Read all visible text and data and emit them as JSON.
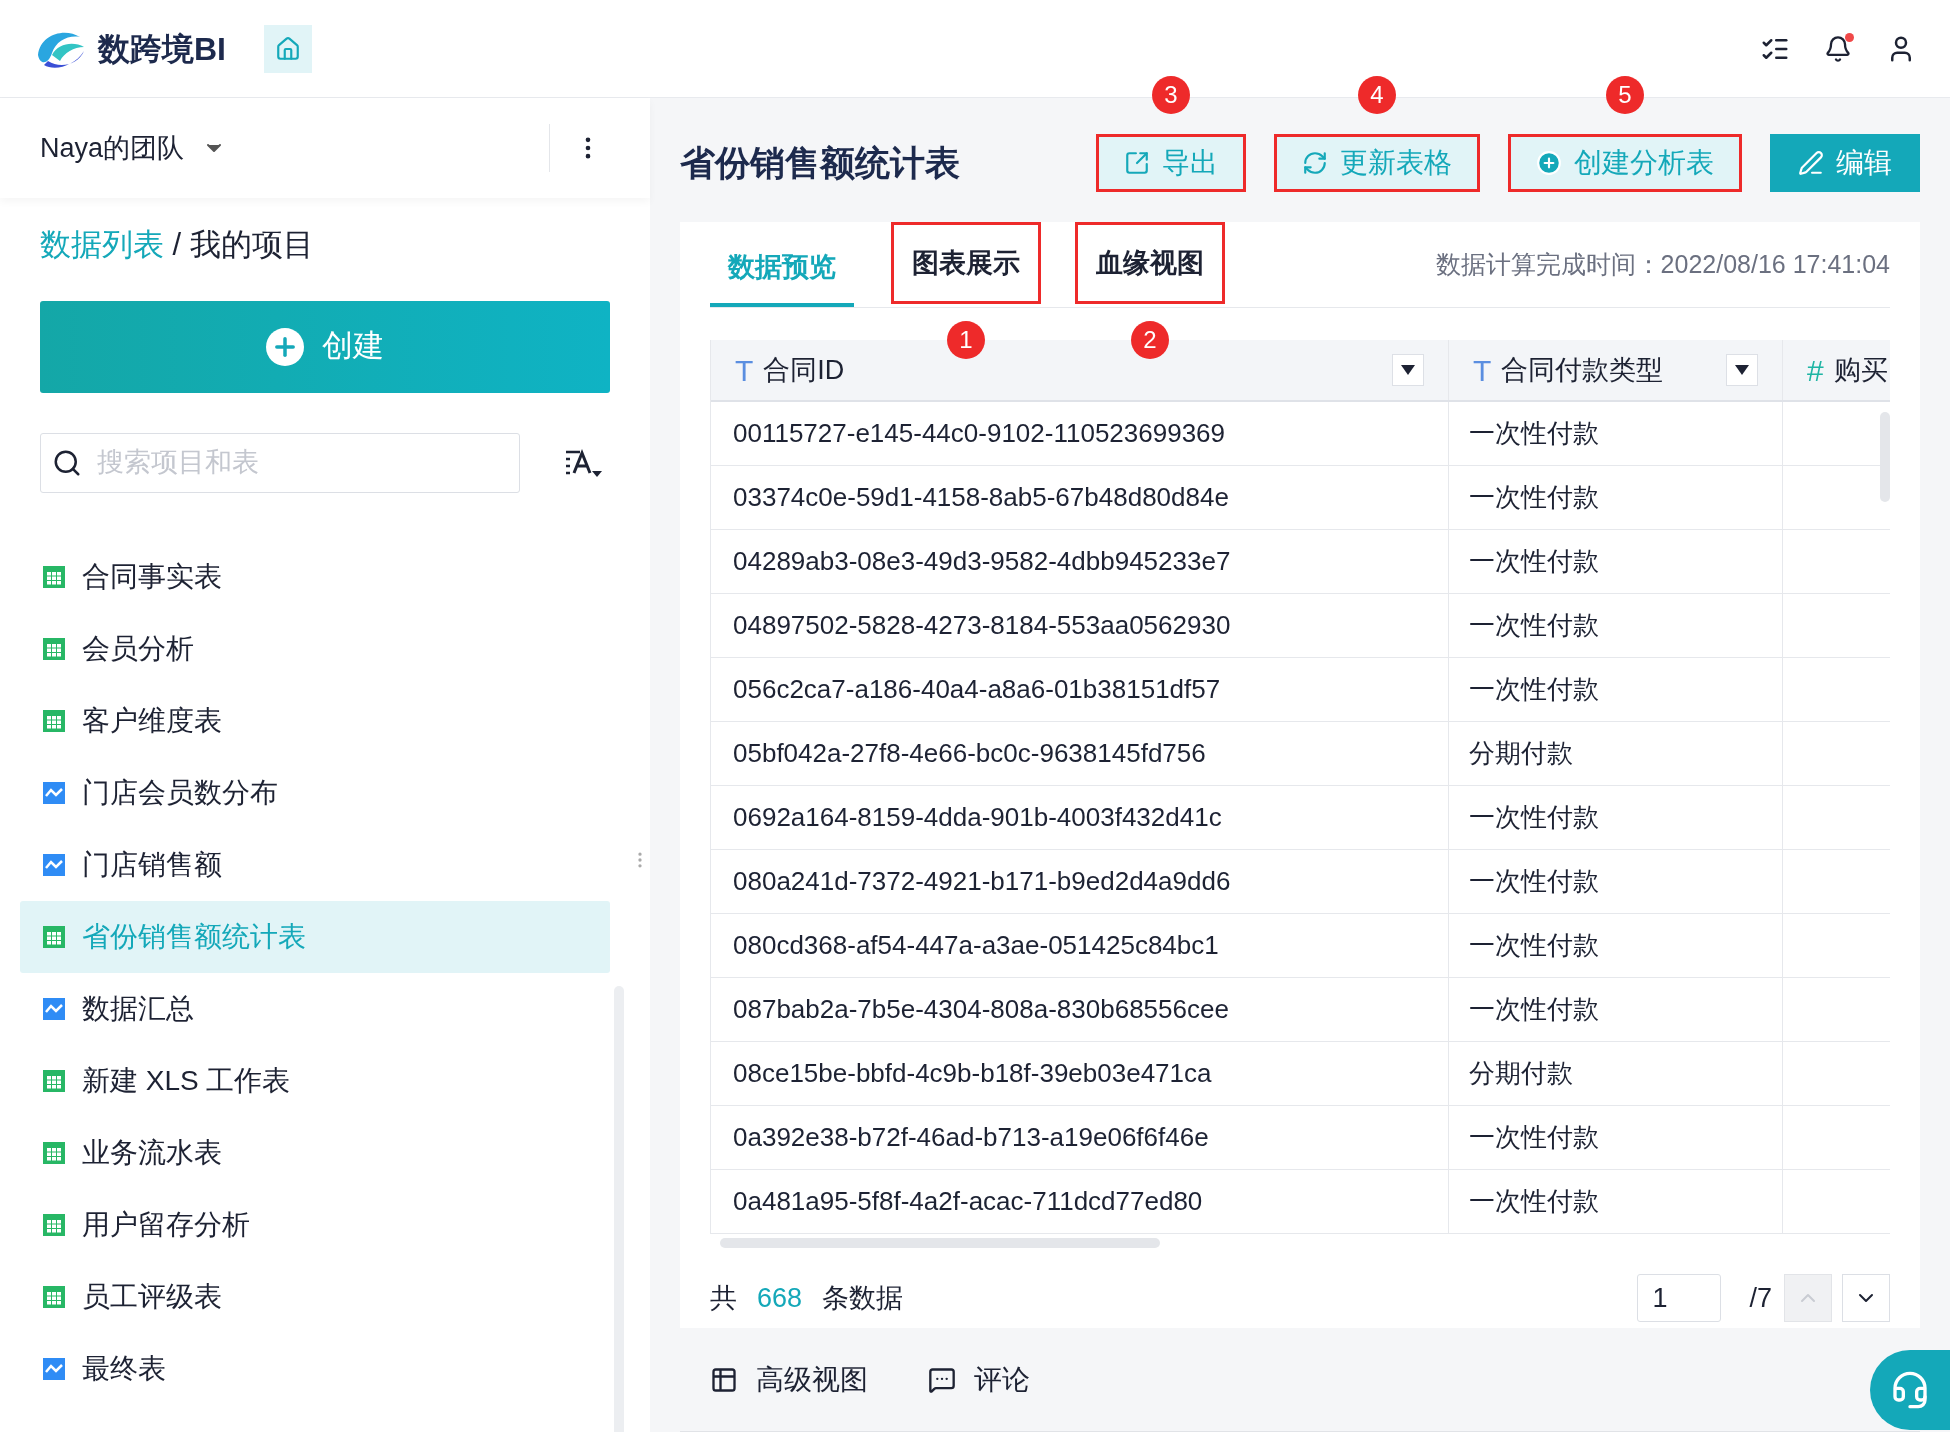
{
  "app": {
    "name": "数跨境BI"
  },
  "sidebar": {
    "team": "Naya的团队",
    "breadcrumb": {
      "link": "数据列表",
      "separator": " / ",
      "current": "我的项目"
    },
    "create_button": "创建",
    "search": {
      "placeholder": "搜索项目和表"
    },
    "items": [
      {
        "label": "合同事实表",
        "kind": "table",
        "selected": false
      },
      {
        "label": "会员分析",
        "kind": "table",
        "selected": false
      },
      {
        "label": "客户维度表",
        "kind": "table",
        "selected": false
      },
      {
        "label": "门店会员数分布",
        "kind": "chart",
        "selected": false
      },
      {
        "label": "门店销售额",
        "kind": "chart",
        "selected": false
      },
      {
        "label": "省份销售额统计表",
        "kind": "table",
        "selected": true
      },
      {
        "label": "数据汇总",
        "kind": "chart",
        "selected": false
      },
      {
        "label": "新建 XLS 工作表",
        "kind": "table",
        "selected": false
      },
      {
        "label": "业务流水表",
        "kind": "table",
        "selected": false
      },
      {
        "label": "用户留存分析",
        "kind": "table",
        "selected": false
      },
      {
        "label": "员工评级表",
        "kind": "table",
        "selected": false
      },
      {
        "label": "最终表",
        "kind": "chart",
        "selected": false
      }
    ]
  },
  "main": {
    "title": "省份销售额统计表",
    "actions": [
      {
        "label": "导出",
        "kind": "export",
        "primary": false,
        "annotation": "3"
      },
      {
        "label": "更新表格",
        "kind": "refresh",
        "primary": false,
        "annotation": "4"
      },
      {
        "label": "创建分析表",
        "kind": "create",
        "primary": false,
        "annotation": "5"
      },
      {
        "label": "编辑",
        "kind": "edit",
        "primary": true
      }
    ],
    "tabs": [
      {
        "label": "数据预览",
        "selected": true
      },
      {
        "label": "图表展示",
        "selected": false,
        "annotation": "1"
      },
      {
        "label": "血缘视图",
        "selected": false,
        "annotation": "2"
      }
    ],
    "computed_time": "数据计算完成时间：2022/08/16 17:41:04",
    "table": {
      "columns": [
        {
          "type_glyph": "T",
          "label": "合同ID",
          "filter": true
        },
        {
          "type_glyph": "T",
          "label": "合同付款类型",
          "filter": true
        },
        {
          "type_glyph": "#",
          "label": "购买"
        }
      ],
      "rows": [
        [
          "00115727-e145-44c0-9102-110523699369",
          "一次性付款"
        ],
        [
          "03374c0e-59d1-4158-8ab5-67b48d80d84e",
          "一次性付款"
        ],
        [
          "04289ab3-08e3-49d3-9582-4dbb945233e7",
          "一次性付款"
        ],
        [
          "04897502-5828-4273-8184-553aa0562930",
          "一次性付款"
        ],
        [
          "056c2ca7-a186-40a4-a8a6-01b38151df57",
          "一次性付款"
        ],
        [
          "05bf042a-27f8-4e66-bc0c-9638145fd756",
          "分期付款"
        ],
        [
          "0692a164-8159-4dda-901b-4003f432d41c",
          "一次性付款"
        ],
        [
          "080a241d-7372-4921-b171-b9ed2d4a9dd6",
          "一次性付款"
        ],
        [
          "080cd368-af54-447a-a3ae-051425c84bc1",
          "一次性付款"
        ],
        [
          "087bab2a-7b5e-4304-808a-830b68556cee",
          "一次性付款"
        ],
        [
          "08ce15be-bbfd-4c9b-b18f-39eb03e471ca",
          "分期付款"
        ],
        [
          "0a392e38-b72f-46ad-b713-a19e06f6f46e",
          "一次性付款"
        ],
        [
          "0a481a95-5f8f-4a2f-acac-711dcd77ed80",
          "一次性付款"
        ]
      ]
    },
    "footer": {
      "prefix": "共",
      "count": "668",
      "suffix": "条数据",
      "page": "1",
      "total_pages": "/7"
    }
  },
  "bottom_bar": [
    {
      "label": "高级视图",
      "kind": "advanced"
    },
    {
      "label": "评论",
      "kind": "comment"
    }
  ]
}
